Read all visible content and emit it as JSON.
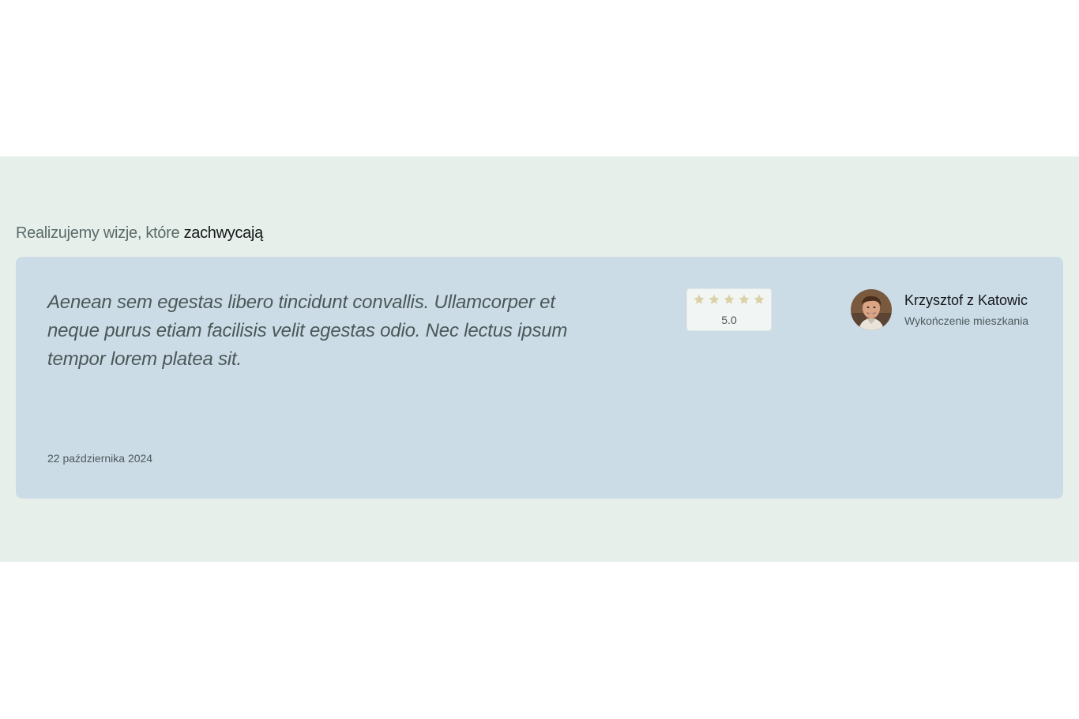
{
  "section": {
    "heading_prefix": "Realizujemy wizje, które ",
    "heading_accent": "zachwycają"
  },
  "testimonial": {
    "quote": "Aenean sem egestas libero tincidunt convallis. Ullamcorper et neque purus etiam facilisis velit egestas odio. Nec lectus ipsum tempor lorem platea sit.",
    "date": "22 października 2024",
    "rating": {
      "value": "5.0",
      "stars_filled": 5,
      "stars_total": 5,
      "star_icon": "star-icon",
      "star_color": "#d9d2a8"
    },
    "author": {
      "name": "Krzysztof z Katowic",
      "subtitle": "Wykończenie mieszkania",
      "avatar_icon": "avatar-photo"
    }
  },
  "colors": {
    "section_bg": "#e7efea",
    "card_bg": "#ccdce7",
    "heading_muted": "#5a6b6a",
    "heading_accent": "#15181a"
  }
}
